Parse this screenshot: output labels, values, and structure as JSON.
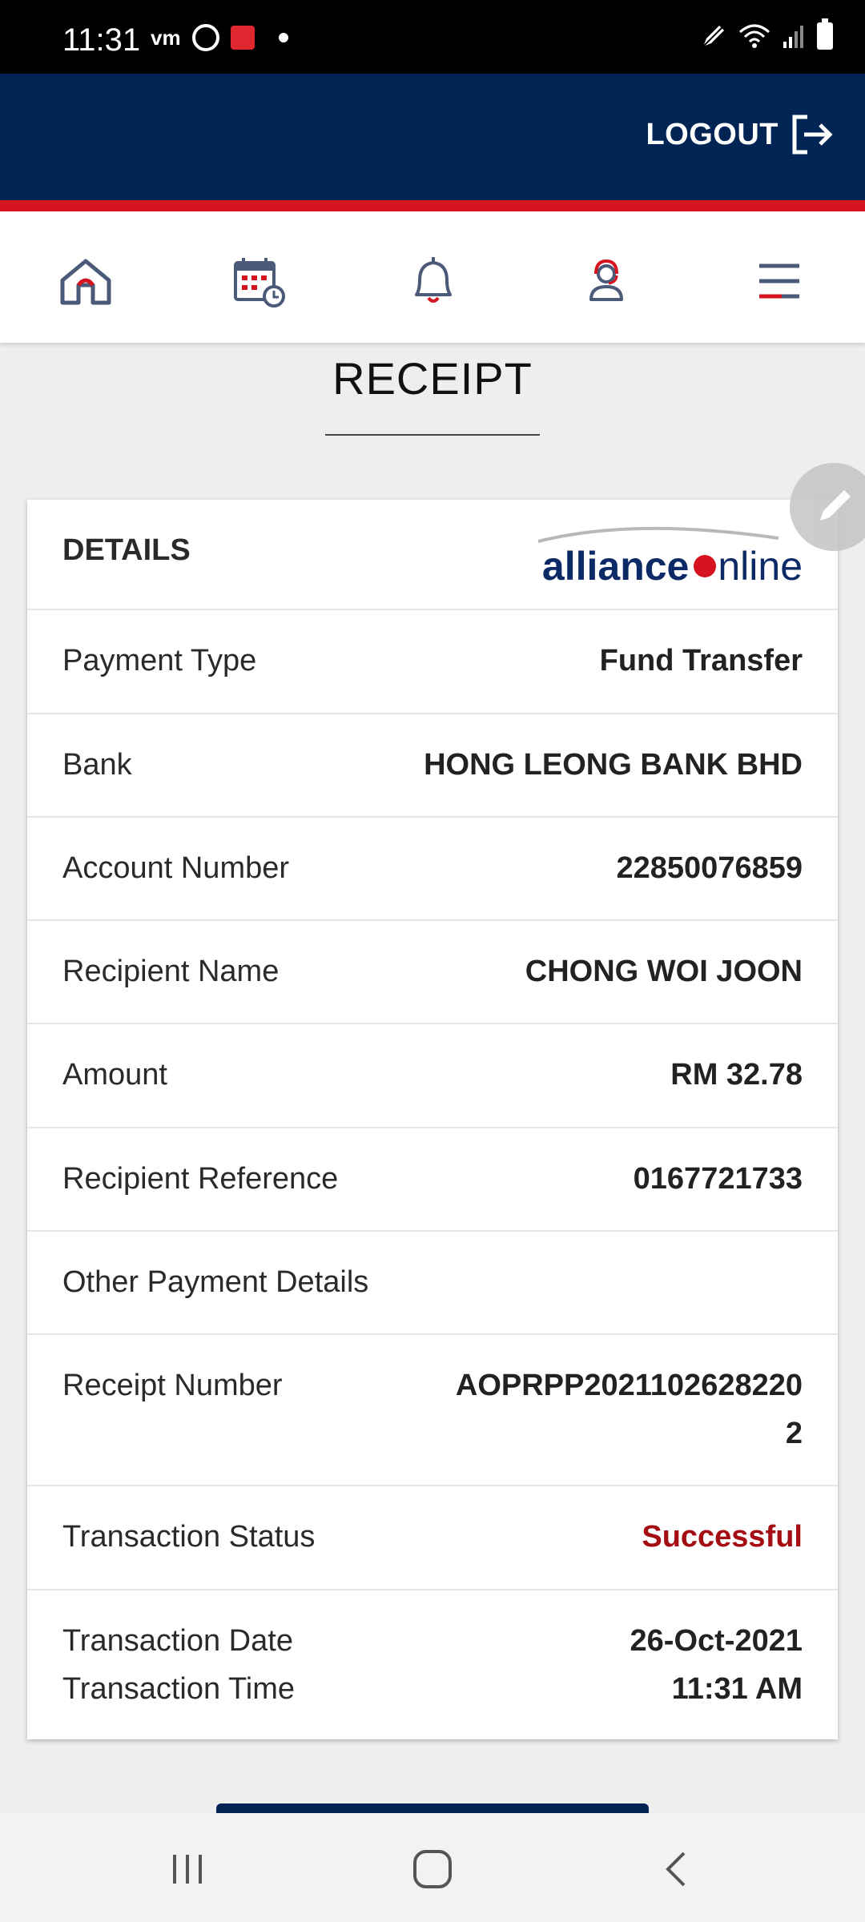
{
  "status_bar": {
    "time": "11:31",
    "carrier_label": "vm",
    "icons": [
      "whatsapp-icon",
      "wow-app-icon",
      "notification-dot",
      "pen-icon",
      "wifi-icon",
      "signal-icon",
      "battery-icon"
    ]
  },
  "header": {
    "logout_label": "LOGOUT",
    "colors": {
      "header_bg": "#002454",
      "accent_red": "#d5141f"
    }
  },
  "nav": {
    "items": [
      "home-icon",
      "calendar-schedule-icon",
      "bell-icon",
      "support-agent-icon",
      "menu-icon"
    ]
  },
  "page": {
    "title": "RECEIPT"
  },
  "card": {
    "header_label": "DETAILS",
    "logo": {
      "text_bold": "alliance",
      "text_regular": "nline"
    },
    "rows": [
      {
        "label": "Payment Type",
        "value": "Fund Transfer"
      },
      {
        "label": "Bank",
        "value": "HONG LEONG BANK BHD"
      },
      {
        "label": "Account Number",
        "value": "22850076859"
      },
      {
        "label": "Recipient Name",
        "value": "CHONG WOI JOON"
      },
      {
        "label": "Amount",
        "value": "RM 32.78"
      },
      {
        "label": "Recipient Reference",
        "value": "0167721733"
      },
      {
        "label": "Other Payment Details",
        "value": ""
      },
      {
        "label": "Receipt Number",
        "value_line1": "AOPRPP2021102628220",
        "value_line2": "2"
      },
      {
        "label": "Transaction Status",
        "value": "Successful",
        "color": "#a40e13"
      },
      {
        "label_line1": "Transaction Date",
        "label_line2": "Transaction Time",
        "value_line1": "26-Oct-2021",
        "value_line2": "11:31 AM"
      }
    ]
  },
  "system_nav": [
    "recent-apps-icon",
    "home-circle-icon",
    "back-icon"
  ]
}
